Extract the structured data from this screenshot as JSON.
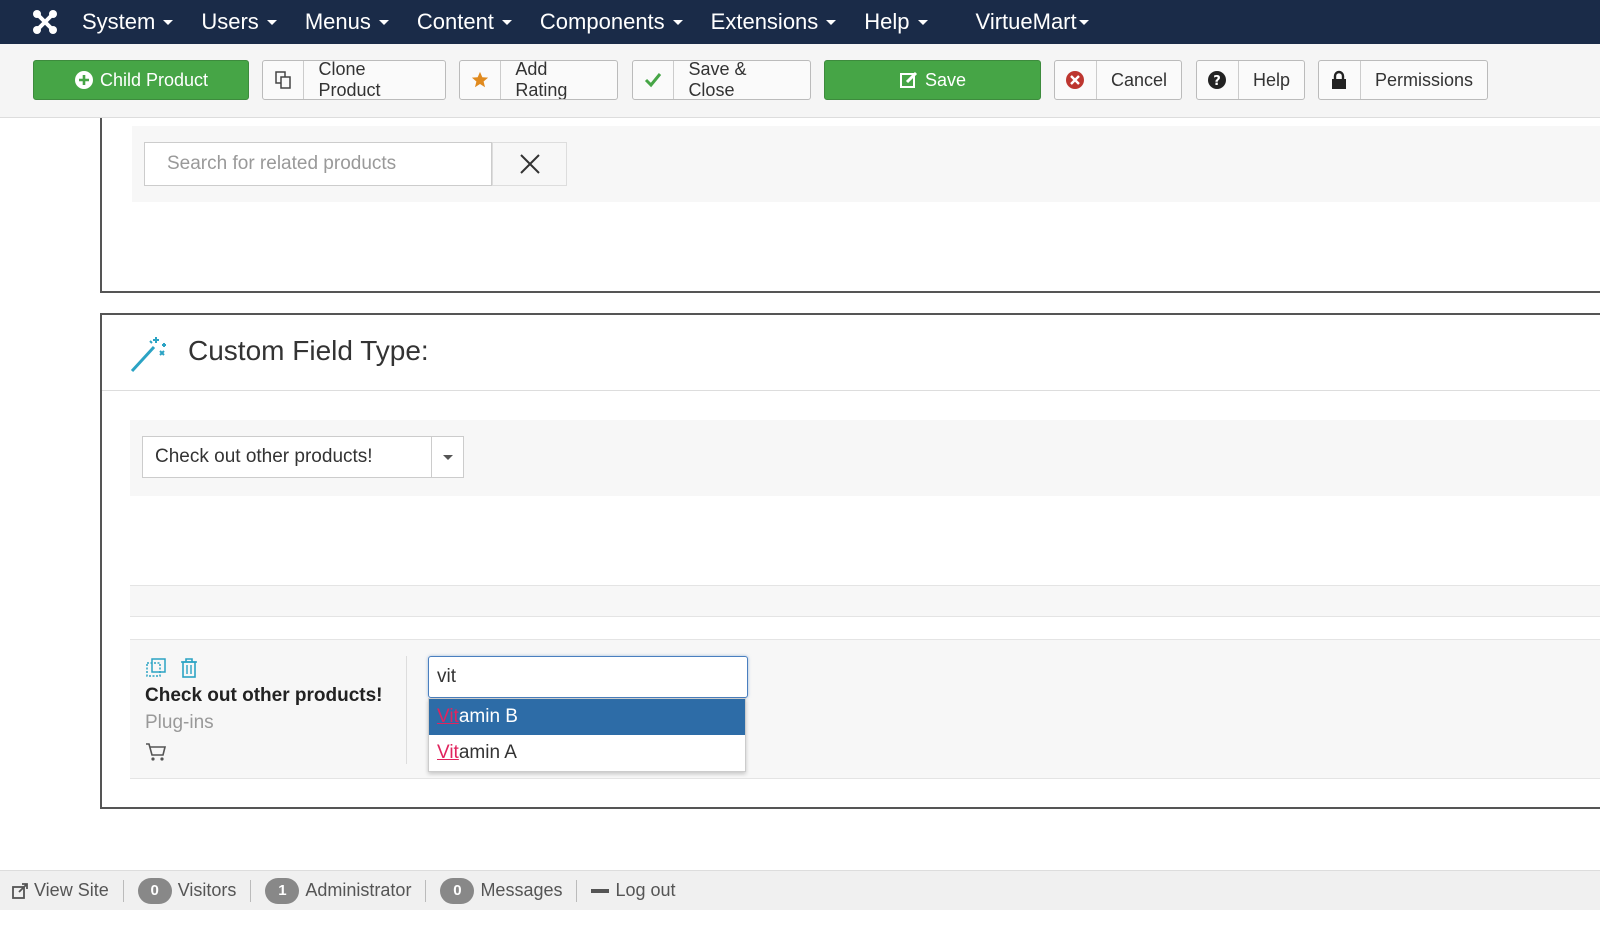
{
  "nav": {
    "items": [
      {
        "label": "System"
      },
      {
        "label": "Users"
      },
      {
        "label": "Menus"
      },
      {
        "label": "Content"
      },
      {
        "label": "Components"
      },
      {
        "label": "Extensions"
      },
      {
        "label": "Help"
      }
    ],
    "virtuemart": "VirtueMart"
  },
  "toolbar": {
    "child_product": "Child Product",
    "clone_product": "Clone Product",
    "add_rating": "Add Rating",
    "save_close": "Save & Close",
    "save": "Save",
    "cancel": "Cancel",
    "help": "Help",
    "permissions": "Permissions"
  },
  "related": {
    "search_placeholder": "Search for related products"
  },
  "custom_field": {
    "title": "Custom Field Type:",
    "selected_type": "Check out other products!"
  },
  "field_row": {
    "name": "Check out other products!",
    "type": "Plug-ins",
    "input_value": "vit",
    "suggestions": [
      {
        "match": "Vit",
        "rest": "amin B",
        "selected": true
      },
      {
        "match": "Vit",
        "rest": "amin A",
        "selected": false
      }
    ]
  },
  "statusbar": {
    "view_site": "View Site",
    "visitors_count": "0",
    "visitors": "Visitors",
    "admin_count": "1",
    "administrator": "Administrator",
    "messages_count": "0",
    "messages": "Messages",
    "logout": "Log out"
  },
  "colors": {
    "nav_bg": "#1a2b48",
    "green": "#46a546",
    "selected": "#2d6ca7",
    "highlight": "#e0245e",
    "teal_icon": "#2ba3c4"
  },
  "icons": [
    "joomla-logo-icon",
    "plus-circle-icon",
    "copy-icon",
    "star-icon",
    "check-icon",
    "edit-icon",
    "cancel-circle-icon",
    "question-circle-icon",
    "lock-icon",
    "close-icon",
    "magic-wand-icon",
    "clone-icon",
    "trash-icon",
    "cart-icon",
    "external-link-icon",
    "minus-icon"
  ]
}
